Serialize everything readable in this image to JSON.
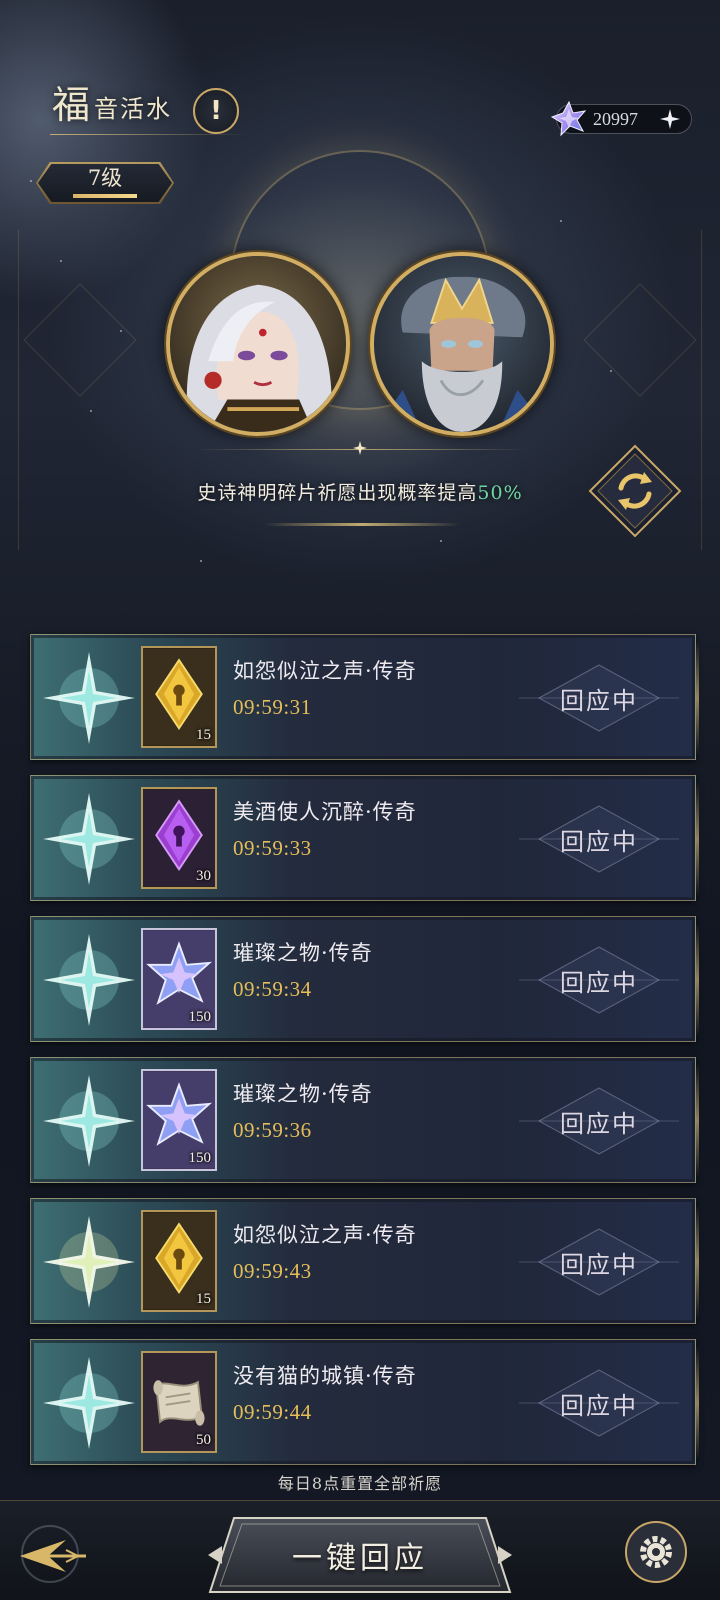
{
  "header": {
    "title_first": "福",
    "title_rest": "音活水",
    "info_symbol": "!",
    "level": "7级",
    "currency": {
      "icon": "crystal-star-icon",
      "value": "20997",
      "add_icon": "sparkle-plus-icon"
    }
  },
  "banner": {
    "bonus_text": "史诗神明碎片祈愿出现概率提高",
    "bonus_pct": "50%",
    "refresh_icon": "refresh-icon"
  },
  "prayers": [
    {
      "item_icon": "golden-shard-icon",
      "count": "15",
      "name": "如怨似泣之声·传奇",
      "timer": "09:59:31",
      "action": "回应中"
    },
    {
      "item_icon": "purple-shard-icon",
      "count": "30",
      "name": "美酒使人沉醉·传奇",
      "timer": "09:59:33",
      "action": "回应中"
    },
    {
      "item_icon": "crystal-star-icon",
      "count": "150",
      "name": "璀璨之物·传奇",
      "timer": "09:59:34",
      "action": "回应中"
    },
    {
      "item_icon": "crystal-star-icon",
      "count": "150",
      "name": "璀璨之物·传奇",
      "timer": "09:59:36",
      "action": "回应中"
    },
    {
      "item_icon": "golden-shard-icon",
      "count": "15",
      "name": "如怨似泣之声·传奇",
      "timer": "09:59:43",
      "action": "回应中"
    },
    {
      "item_icon": "scroll-icon",
      "count": "50",
      "name": "没有猫的城镇·传奇",
      "timer": "09:59:44",
      "action": "回应中"
    }
  ],
  "reset_note": "每日8点重置全部祈愿",
  "bottom": {
    "main_action": "一键回应",
    "back_icon": "back-arrow-icon",
    "settings_icon": "gear-icon"
  },
  "colors": {
    "accent_gold": "#d2ae63",
    "timer": "#e6bd58",
    "bonus_green": "#6fd6a4",
    "card_teal": "#3e6f73"
  }
}
